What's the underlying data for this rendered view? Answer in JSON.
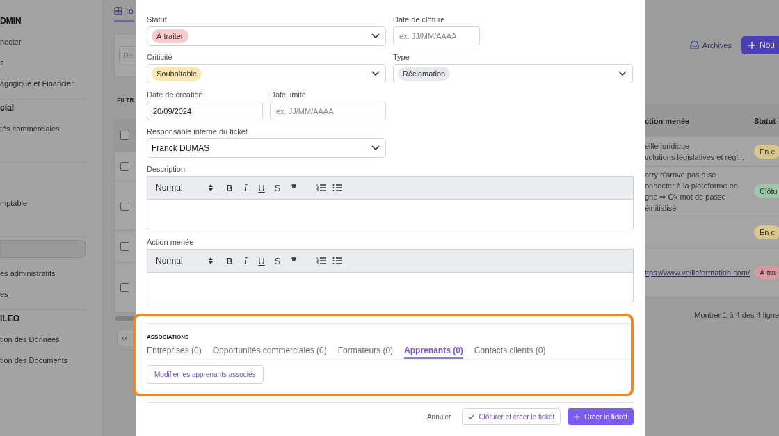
{
  "sidebar": {
    "groups": [
      {
        "items": [
          {
            "label": "DMIN",
            "kind": "heading",
            "selected": false
          },
          {
            "label": "necter",
            "kind": "link",
            "selected": false
          },
          {
            "label": "s",
            "kind": "link",
            "selected": false
          },
          {
            "label": "agogique et Financier",
            "kind": "link",
            "selected": false
          }
        ]
      },
      {
        "items": [
          {
            "label": "cial",
            "kind": "heading",
            "selected": false
          },
          {
            "label": "tés commerciales",
            "kind": "link",
            "selected": false
          }
        ]
      },
      {
        "items": [
          {
            "label": "mptable",
            "kind": "link",
            "selected": false
          }
        ]
      },
      {
        "items": [
          {
            "selected": true
          },
          {
            "label": "es administratifs",
            "kind": "link",
            "selected": false
          },
          {
            "label": "es",
            "kind": "link",
            "selected": false
          }
        ]
      },
      {
        "items": [
          {
            "label": "ILEO",
            "kind": "heading",
            "selected": false
          },
          {
            "label": "tion des Données",
            "kind": "link",
            "selected": false
          },
          {
            "label": "tion des Documents",
            "kind": "link",
            "selected": false
          }
        ]
      }
    ]
  },
  "background": {
    "tab": {
      "label": "To",
      "selected": true
    },
    "search": {
      "placeholder": "Re"
    },
    "filters_label": "FILTR",
    "archives_button": "Archives",
    "new_button": "Nou",
    "table": {
      "columns": [
        "ction menée",
        "Statut"
      ],
      "header_checked": false,
      "rows": [
        {
          "checked": false,
          "action": [
            "eille juridique",
            "volutions législatives et régl..."
          ],
          "status": "En c",
          "color": "#d9c68a"
        },
        {
          "checked": false,
          "action": [
            "arry n'arrive pas à se",
            "onnecter à la plateforme en",
            "gne ⇒ Ok mot de passe",
            "éinitialisé"
          ],
          "status": "Clôtu",
          "color": "#9cc7a8"
        },
        {
          "checked": false,
          "action": [],
          "status": "En c",
          "color": "#d9c68a"
        },
        {
          "checked": false,
          "link": "ttps://www.veilleformation.com/",
          "status": "À tra",
          "color": "#d59a9e"
        }
      ]
    },
    "pagination": {
      "first": "‹‹",
      "summary": "Montrer 1 à 4 des 4 ligne"
    }
  },
  "modal": {
    "rows": [
      [
        {
          "label": "Statut",
          "kind": "select",
          "badge": "À traiter",
          "color": "#f8cbcf"
        },
        {
          "label": "Date de clôture",
          "kind": "date",
          "placeholder": "ex. JJ/MM/AAAA"
        }
      ],
      [
        {
          "label": "Criticité",
          "kind": "select",
          "badge": "Souhaitable",
          "color": "#fbe8b3"
        },
        {
          "label": "Type",
          "kind": "select",
          "badge": "Réclamation",
          "color": "#e8e9ee"
        }
      ],
      [
        {
          "label": "Date de création",
          "kind": "date",
          "value": "20/09/2024"
        },
        {
          "label": "Date limite",
          "kind": "date",
          "placeholder": "ex. JJ/MM/AAAA"
        }
      ],
      [
        {
          "label": "Responsable interne du ticket",
          "kind": "select",
          "value": "Franck DUMAS"
        }
      ]
    ],
    "editors": [
      {
        "label": "Description",
        "format": "Normal",
        "tools": [
          {
            "glyph": "B",
            "kind": "bold"
          },
          {
            "glyph": "I",
            "kind": "italic"
          },
          {
            "glyph": "U",
            "kind": "underline"
          },
          {
            "glyph": "S",
            "kind": "strike"
          },
          {
            "glyph": "❞",
            "kind": "quote"
          }
        ]
      },
      {
        "label": "Action menée",
        "format": "Normal",
        "tools": [
          {
            "glyph": "B",
            "kind": "bold"
          },
          {
            "glyph": "I",
            "kind": "italic"
          },
          {
            "glyph": "U",
            "kind": "underline"
          },
          {
            "glyph": "S",
            "kind": "strike"
          },
          {
            "glyph": "❞",
            "kind": "quote"
          }
        ]
      }
    ],
    "associations": {
      "title": "ASSOCIATIONS",
      "tabs": [
        {
          "label": "Entreprises (0)",
          "selected": false
        },
        {
          "label": "Opportunités commerciales (0)",
          "selected": false
        },
        {
          "label": "Formateurs (0)",
          "selected": false
        },
        {
          "label": "Apprenants (0)",
          "selected": true
        },
        {
          "label": "Contacts clients (0)",
          "selected": false
        }
      ],
      "button": "Modifier les apprenants associés"
    },
    "footer": {
      "cancel": "Annuler",
      "close_create": "Clôturer et créer le ticket",
      "create": "Créer le ticket"
    }
  }
}
